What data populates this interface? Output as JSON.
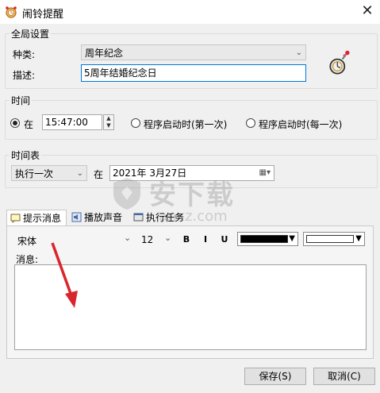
{
  "window": {
    "title": "闹铃提醒",
    "close_glyph": "✕"
  },
  "global": {
    "group_label": "全局设置",
    "kind_label": "种类:",
    "kind_value": "周年纪念",
    "desc_label": "描述:",
    "desc_value": "5周年结婚纪念日"
  },
  "time": {
    "group_label": "时间",
    "at_label": "在",
    "time_value": "15:47:00",
    "option_first": "程序启动时(第一次)",
    "option_every": "程序启动时(每一次)",
    "selected": "at"
  },
  "schedule": {
    "group_label": "时间表",
    "mode_value": "执行一次",
    "at_label": "在",
    "date_value": "2021年 3月27日"
  },
  "tabs": [
    {
      "label": "提示消息",
      "icon": "message-tab-icon",
      "active": true
    },
    {
      "label": "播放声音",
      "icon": "sound-tab-icon",
      "active": false
    },
    {
      "label": "执行任务",
      "icon": "task-tab-icon",
      "active": false
    }
  ],
  "message": {
    "font_value": "宋体",
    "size_value": "12",
    "bold": "B",
    "italic": "I",
    "underline": "U",
    "fore_color": "#000000",
    "back_color": "#ffffff",
    "message_label": "消息:",
    "message_text": ""
  },
  "buttons": {
    "save": "保存(S)",
    "cancel": "取消(C)"
  },
  "watermark": {
    "text": "安下载",
    "sub": "anxz.com"
  },
  "colors": {
    "accent": "#0078d7",
    "arrow": "#d9262c"
  }
}
